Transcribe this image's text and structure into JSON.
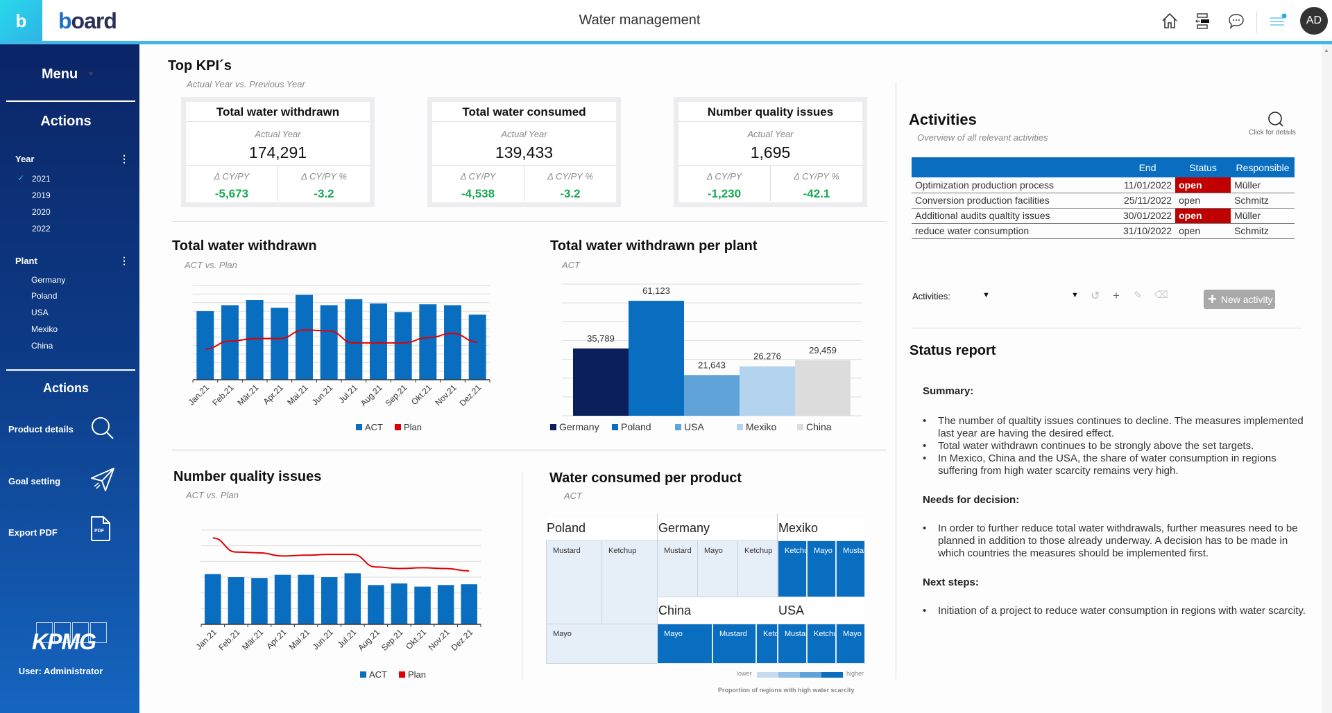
{
  "header": {
    "logo_letter": "b",
    "brand_name_first": "b",
    "brand_name_rest": "oard",
    "title": "Water management",
    "icons": [
      "home-icon",
      "layout-icon",
      "comment-icon",
      "notifications-icon"
    ],
    "avatar_initials": "AD"
  },
  "sidebar": {
    "menu_label": "Menu",
    "filters_heading": "Actions",
    "year": {
      "label": "Year",
      "items": [
        {
          "label": "2021",
          "selected": true
        },
        {
          "label": "2019",
          "selected": false
        },
        {
          "label": "2020",
          "selected": false
        },
        {
          "label": "2022",
          "selected": false
        }
      ]
    },
    "plant": {
      "label": "Plant",
      "items": [
        "Germany",
        "Poland",
        "USA",
        "Mexiko",
        "China"
      ]
    },
    "actions_heading": "Actions",
    "actions": [
      {
        "label": "Product details",
        "icon": "search-icon"
      },
      {
        "label": "Goal setting",
        "icon": "paper-plane-icon"
      },
      {
        "label": "Export PDF",
        "icon": "pdf-file-icon",
        "icon_text": "PDF"
      }
    ],
    "company_logo": "KPMG",
    "user_label": "User: Administrator"
  },
  "kpis": {
    "title": "Top KPI´s",
    "subtitle": "Actual Year vs. Previous Year",
    "cards": [
      {
        "title": "Total water withdrawn",
        "period_label": "Actual Year",
        "value": "174,291",
        "delta_label": "Δ CY/PY",
        "delta": "-5,673",
        "delta_pct_label": "Δ CY/PY %",
        "delta_pct": "-3.2"
      },
      {
        "title": "Total water consumed",
        "period_label": "Actual Year",
        "value": "139,433",
        "delta_label": "Δ CY/PY",
        "delta": "-4,538",
        "delta_pct_label": "Δ CY/PY %",
        "delta_pct": "-3.2"
      },
      {
        "title": "Number quality issues",
        "period_label": "Actual Year",
        "value": "1,695",
        "delta_label": "Δ CY/PY",
        "delta": "-1,230",
        "delta_pct_label": "Δ CY/PY %",
        "delta_pct": "-42.1"
      }
    ],
    "positive_color": "#18a854"
  },
  "chart_data": [
    {
      "id": "withdrawn",
      "type": "bar",
      "title": "Total water withdrawn",
      "subtitle": "ACT vs. Plan",
      "categories": [
        "Jan.21",
        "Feb.21",
        "Mär.21",
        "Apr.21",
        "Mai.21",
        "Jun.21",
        "Jul.21",
        "Aug.21",
        "Sep.21",
        "Okt.21",
        "Nov.21",
        "Dez.21"
      ],
      "series": [
        {
          "name": "ACT",
          "kind": "bar",
          "color": "#0a6ec0",
          "values": [
            8.0,
            8.7,
            9.3,
            8.4,
            9.9,
            8.7,
            9.4,
            8.9,
            7.9,
            8.8,
            8.7,
            7.6
          ]
        },
        {
          "name": "Plan",
          "kind": "line",
          "color": "#e00000",
          "values": [
            3.6,
            4.5,
            4.8,
            4.8,
            5.8,
            5.7,
            4.3,
            4.3,
            4.3,
            4.9,
            5.4,
            4.4
          ]
        }
      ],
      "ylim": [
        0,
        11
      ],
      "grid": true,
      "legend": "bottom",
      "xlabel": "",
      "ylabel": ""
    },
    {
      "id": "per_plant",
      "type": "bar",
      "title": "Total water withdrawn per plant",
      "subtitle": "ACT",
      "categories": [
        "Germany",
        "Poland",
        "USA",
        "Mexiko",
        "China"
      ],
      "values": [
        35789,
        61123,
        21643,
        26276,
        29459
      ],
      "value_labels": [
        "35,789",
        "61,123",
        "21,643",
        "26,276",
        "29,459"
      ],
      "colors": [
        "#0b1f5c",
        "#0a6ec0",
        "#5fa3d8",
        "#b3d3ee",
        "#dcdcdc"
      ],
      "ylim": [
        0,
        70000
      ],
      "grid": true,
      "legend": "bottom",
      "xlabel": "",
      "ylabel": ""
    },
    {
      "id": "quality",
      "type": "bar",
      "title": "Number quality issues",
      "subtitle": "ACT vs. Plan",
      "categories": [
        "Jan.21",
        "Feb.21",
        "Mär.21",
        "Apr.21",
        "Mai.21",
        "Jun.21",
        "Jul.21",
        "Aug.21",
        "Sep.21",
        "Okt.21",
        "Nov.21",
        "Dez.21"
      ],
      "series": [
        {
          "name": "ACT",
          "kind": "bar",
          "color": "#0a6ec0",
          "values": [
            3.2,
            3.0,
            2.95,
            3.15,
            3.15,
            3.0,
            3.25,
            2.5,
            2.6,
            2.4,
            2.5,
            2.55
          ]
        },
        {
          "name": "Plan",
          "kind": "line",
          "color": "#e00000",
          "values": [
            5.5,
            4.6,
            4.55,
            4.35,
            4.4,
            4.45,
            4.45,
            3.65,
            3.55,
            3.6,
            3.55,
            3.4
          ]
        }
      ],
      "ylim": [
        0,
        6
      ],
      "grid": true,
      "legend": "bottom",
      "xlabel": "",
      "ylabel": ""
    },
    {
      "id": "per_product",
      "type": "heatmap",
      "title": "Water consumed per product",
      "subtitle": "ACT",
      "regions": [
        {
          "name": "Poland",
          "products": [
            "Mustard",
            "Ketchup",
            "Mayo"
          ],
          "scarcity": "lower"
        },
        {
          "name": "Germany",
          "products": [
            "Mustard",
            "Mayo",
            "Ketchup"
          ],
          "scarcity": "lower"
        },
        {
          "name": "Mexiko",
          "products": [
            "Ketchup",
            "Mayo",
            "Mustard"
          ],
          "scarcity": "higher"
        },
        {
          "name": "China",
          "products": [
            "Mayo",
            "Mustard",
            "Ketchup"
          ],
          "scarcity": "higher"
        },
        {
          "name": "USA",
          "products": [
            "Mustard",
            "Ketchup",
            "Mayo"
          ],
          "scarcity": "higher"
        }
      ],
      "legend_low": "lower",
      "legend_high": "higher",
      "legend_title": "Proportion of regions with high water scarcity",
      "legend_colors": [
        "#c6dcf0",
        "#93bfe6",
        "#5fa3d8",
        "#0a6ec0"
      ]
    }
  ],
  "activities": {
    "title": "Activities",
    "subtitle": "Overview of all relevant activities",
    "details_label": "Click for details",
    "columns": [
      "",
      "End",
      "Status",
      "Responsible"
    ],
    "rows": [
      {
        "name": "Optimization production process",
        "end": "11/01/2022",
        "status": "open",
        "highlight": true,
        "responsible": "Müller"
      },
      {
        "name": "Conversion production facilities",
        "end": "25/11/2022",
        "status": "open",
        "highlight": false,
        "responsible": "Schmitz"
      },
      {
        "name": "Additional audits qualtity issues",
        "end": "30/01/2022",
        "status": "open",
        "highlight": true,
        "responsible": "Müller"
      },
      {
        "name": "reduce water consumption",
        "end": "31/10/2022",
        "status": "open",
        "highlight": false,
        "responsible": "Schmitz"
      }
    ],
    "header_color": "#0a6ec0",
    "alert_color": "#c00000",
    "toolbar": {
      "label": "Activities:",
      "new_button": "New activity"
    }
  },
  "status_report": {
    "title": "Status report",
    "sections": [
      {
        "heading": "Summary:",
        "bullets": [
          "The number of qualtity issues continues to decline. The measures implemented last year are having the desired effect.",
          "Total water withdrawn continues to be strongly above the set targets.",
          "In Mexico, China and the USA, the share of water consumption in regions suffering from high water scarcity remains very high."
        ]
      },
      {
        "heading": "Needs for decision:",
        "bullets": [
          "In order to further reduce total water withdrawals, further measures need to be planned in addition to those already underway. A decision has to be made in which countries the measures should be implemented first."
        ]
      },
      {
        "heading": "Next steps:",
        "bullets": [
          "Initiation of a project to reduce water consumption in regions with water scarcity."
        ]
      }
    ]
  }
}
